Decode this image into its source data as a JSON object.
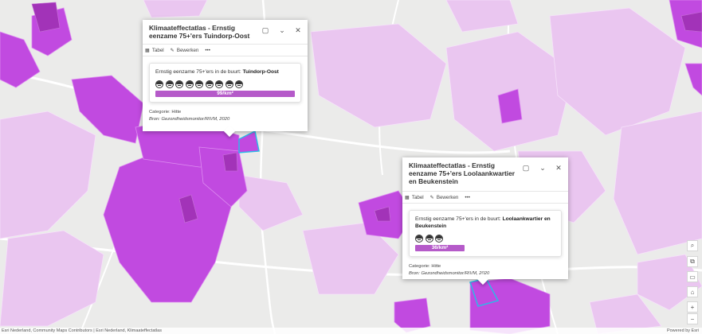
{
  "popup1": {
    "title": "Klimaateffectatlas - Ernstig eenzame 75+'ers Tuindorp-Oost",
    "toolbar": {
      "table_label": "Tabel",
      "edit_label": "Bewerken",
      "more_label": "•••"
    },
    "card": {
      "prefix": "Ernstig eenzame 75+'ers in de buurt: ",
      "area": "Tuindorp-Oost",
      "icon_count": 9,
      "value_label": "99/km²"
    },
    "category": "Categorie: Hitte",
    "source": "Bron: Gezondheidsmonitor/RIVM, 2020"
  },
  "popup2": {
    "title": "Klimaateffectatlas - Ernstig eenzame 75+'ers Loolaankwartier en Beukenstein",
    "toolbar": {
      "table_label": "Tabel",
      "edit_label": "Bewerken",
      "more_label": "•••"
    },
    "card": {
      "prefix": "Ernstig eenzame 75+'ers in de buurt: ",
      "area": "Loolaankwartier en Beukenstein",
      "icon_count": 3,
      "value_label": "36/km²"
    },
    "category": "Categorie: Hitte",
    "source": "Bron: Gezondheidsmonitor/RIVM, 2020"
  },
  "map_controls": {
    "search": "search-icon",
    "layers": "layers-icon",
    "screen": "screen-icon",
    "home": "home-icon",
    "zoom_in": "+",
    "zoom_out": "−"
  },
  "attribution": {
    "left": "Esri Nederland, Community Maps Contributors | Esri Nederland, Klimaateffectatlas",
    "right": "Powered by Esri"
  },
  "colors": {
    "base": "#ebebea",
    "light_purple": "#eac6f0",
    "mid_purple": "#d78ae6",
    "strong_purple": "#c14ae0",
    "dark_purple": "#a233b8",
    "bar": "#b55ac9",
    "highlight": "#2db8e8"
  }
}
